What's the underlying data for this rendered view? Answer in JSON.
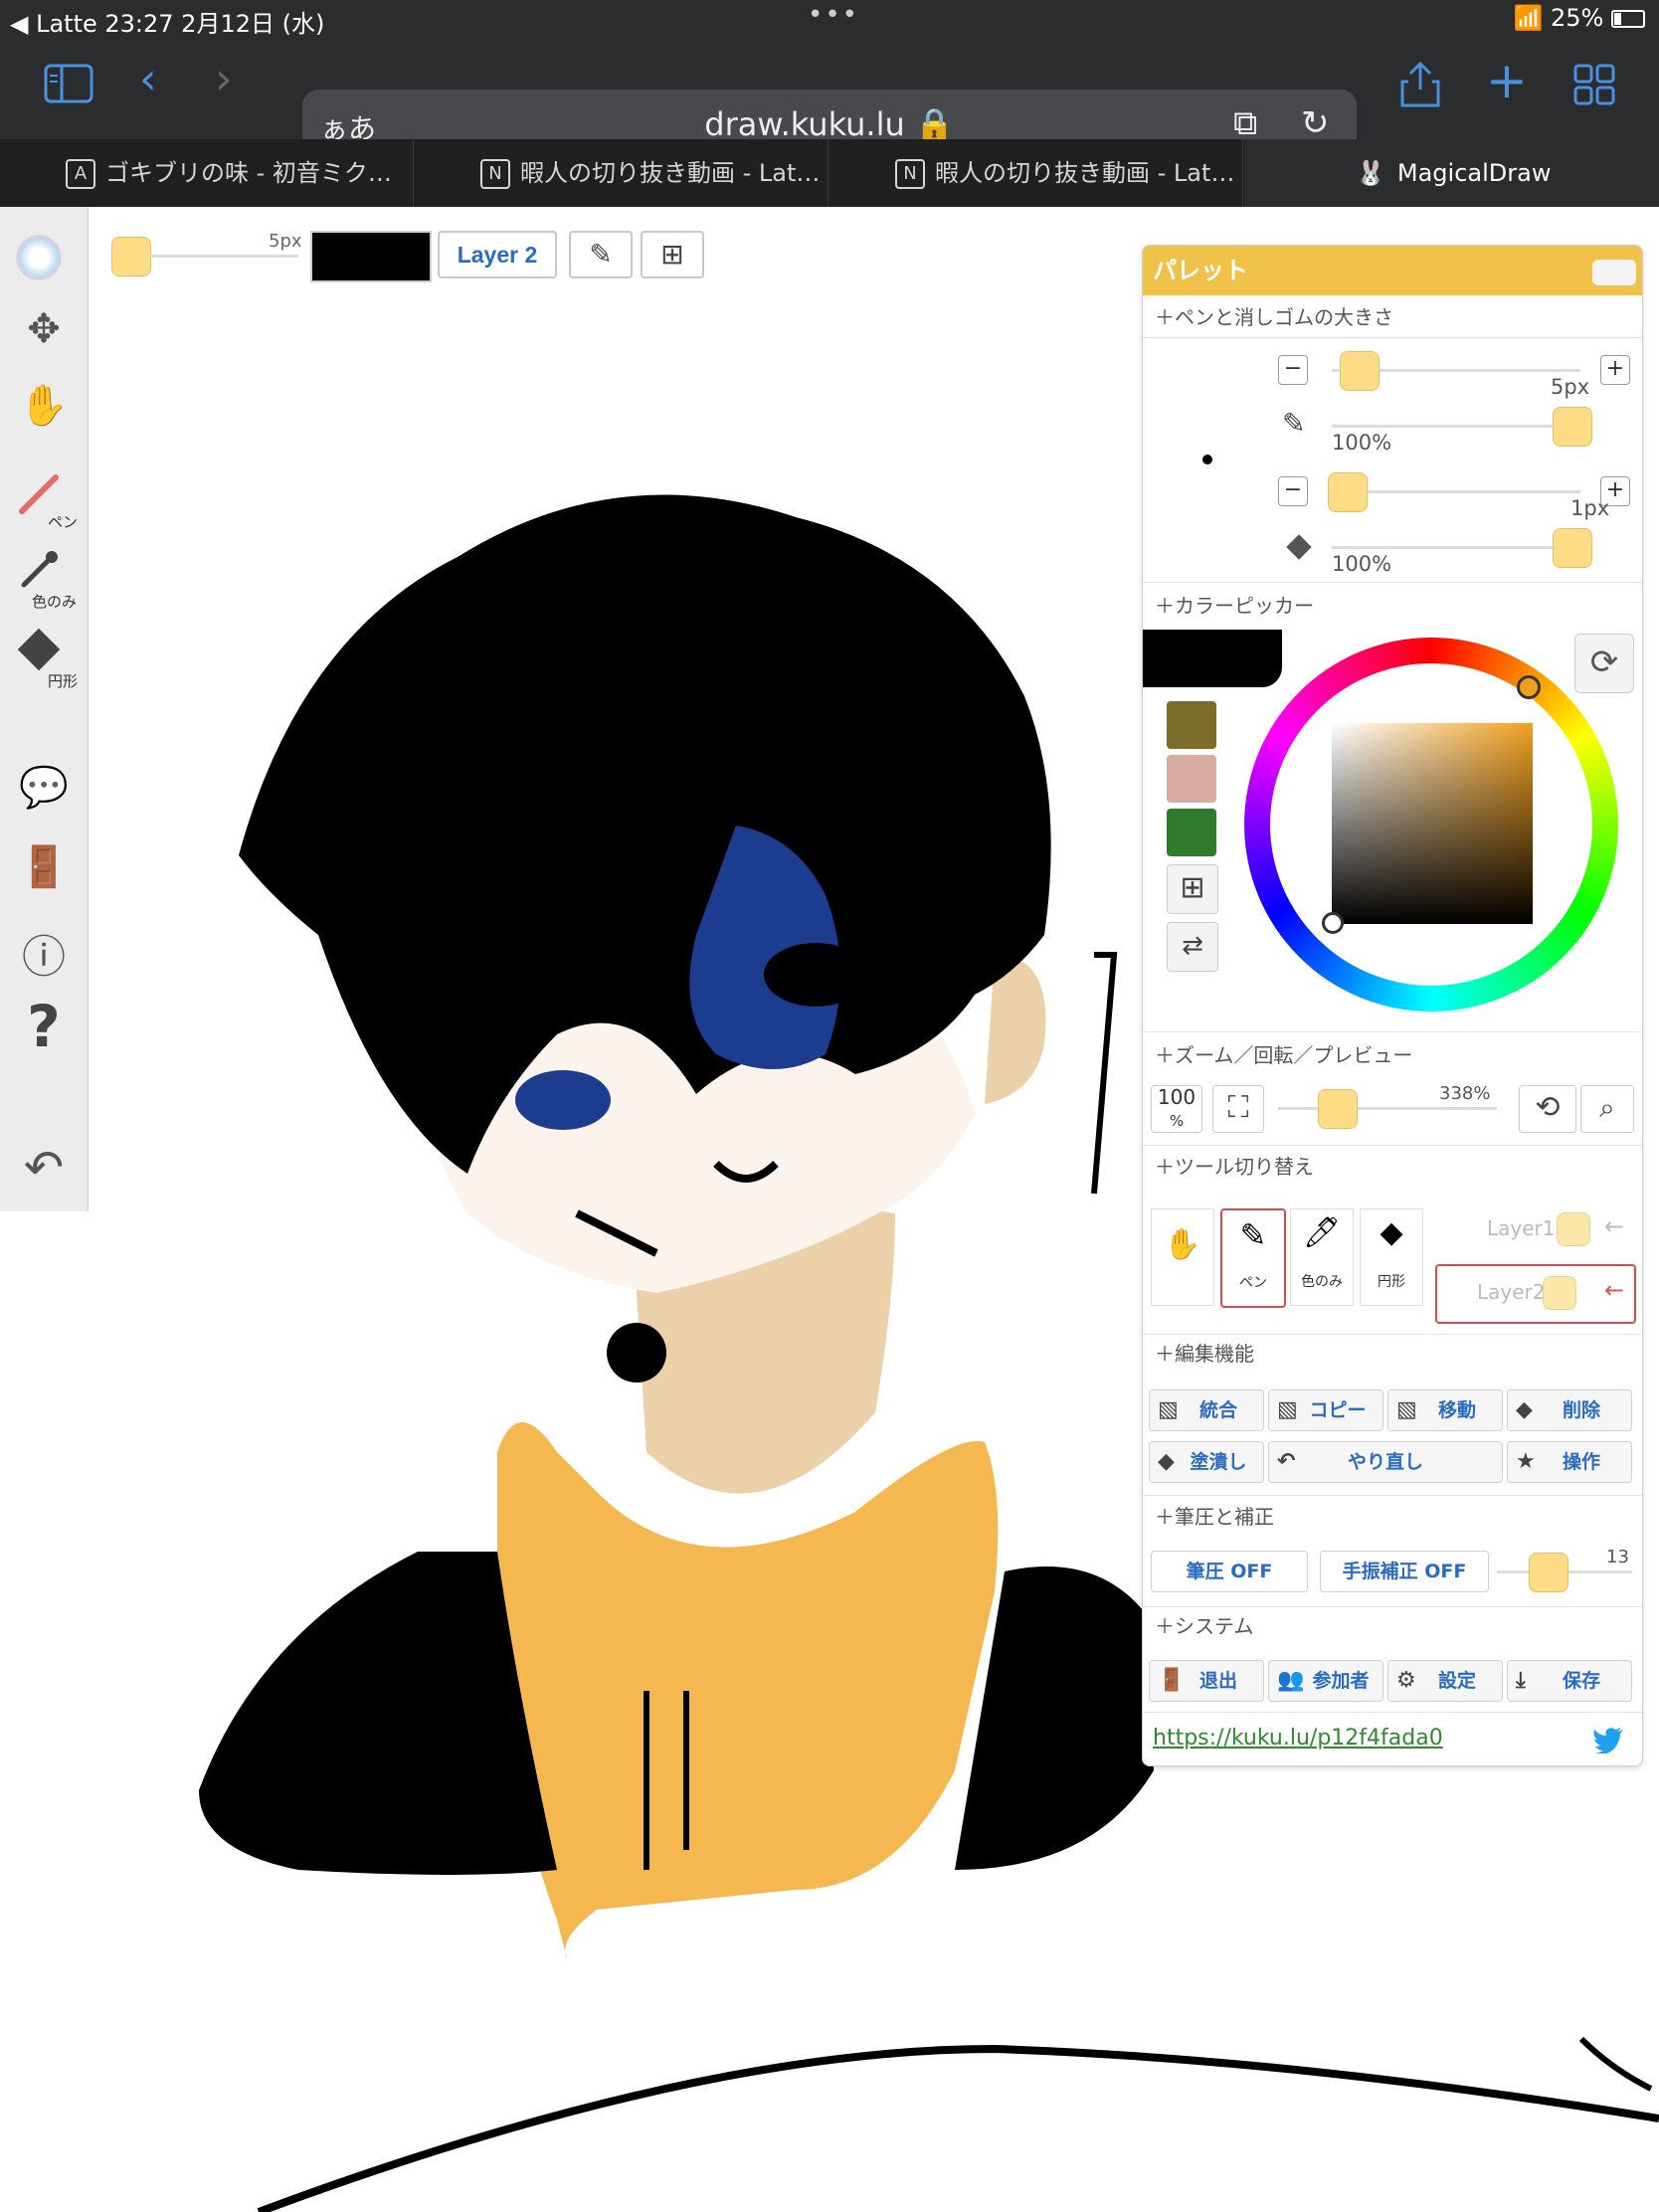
{
  "status": {
    "left": "◀ Latte  23:27  2月12日 (水)",
    "right": "25%",
    "dots": "•••"
  },
  "urlbar": {
    "aa": "ぁあ",
    "url": "draw.kuku.lu 🔒"
  },
  "tabs": [
    {
      "badge": "A",
      "label": "ゴキブリの味 - 初音ミク…"
    },
    {
      "badge": "N",
      "label": "暇人の切り抜き動画 - Lat…"
    },
    {
      "badge": "N",
      "label": "暇人の切り抜き動画 - Lat…"
    },
    {
      "badge": "🐰",
      "label": "MagicalDraw"
    }
  ],
  "tab_close": "✕",
  "leftbar": {
    "pen_label": "ペン",
    "dropper_label": "色のみ",
    "shape_label": "円形"
  },
  "top_controls": {
    "size": "5px",
    "layer": "Layer 2"
  },
  "palette": {
    "title": "パレット",
    "sections": {
      "size": "＋ペンと消しゴムの大きさ",
      "picker": "＋カラーピッカー",
      "zoom": "＋ズーム／回転／プレビュー",
      "tools": "＋ツール切り替え",
      "edit": "＋編集機能",
      "pressure": "＋筆圧と補正",
      "system": "＋システム"
    },
    "pen": {
      "size": "5px",
      "opacity": "100%"
    },
    "eraser": {
      "size": "1px",
      "opacity": "100%"
    },
    "swatches": [
      "#7d6d2a",
      "#d8aba3",
      "#2f7a2b"
    ],
    "current_color": "#000000",
    "zoom": {
      "level": "100",
      "unit": "%",
      "value": "338%"
    },
    "tool_cells": [
      "ペン",
      "色のみ",
      "円形"
    ],
    "layers": [
      "Layer1",
      "Layer2"
    ],
    "edit_buttons": [
      "統合",
      "コピー",
      "移動",
      "削除"
    ],
    "edit_buttons2": [
      "塗潰し",
      "やり直し",
      "操作"
    ],
    "pressure": {
      "pen_pressure": "筆圧 OFF",
      "stabilizer": "手振補正 OFF",
      "value": "13"
    },
    "system_buttons": [
      "退出",
      "参加者",
      "設定",
      "保存"
    ],
    "link": "https://kuku.lu/p12f4fada0"
  },
  "colors": {
    "accent": "#f1c24a",
    "blue": "#2a6bc3",
    "knob": "#fddc85"
  }
}
